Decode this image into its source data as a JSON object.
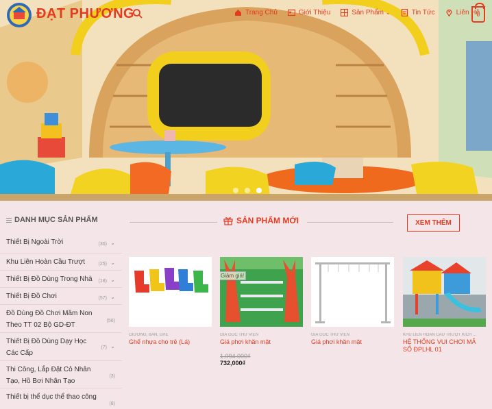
{
  "header": {
    "brand": "ĐẠT PHƯƠNG",
    "nav": [
      {
        "label": "Trang Chủ",
        "icon": "home-icon"
      },
      {
        "label": "Giới Thiệu",
        "icon": "id-card-icon"
      },
      {
        "label": "Sản Phẩm",
        "icon": "grid-icon",
        "dropdown": true
      },
      {
        "label": "Tin Tức",
        "icon": "document-icon"
      },
      {
        "label": "Liên Hệ",
        "icon": "map-pin-icon"
      }
    ],
    "cart_count": "0"
  },
  "sidebar": {
    "title": "DANH MỤC SẢN PHẨM",
    "categories": [
      {
        "label": "Thiết Bị Ngoài Trời",
        "count": "(36)"
      },
      {
        "label": "Khu Liên Hoàn Cầu Trượt",
        "count": "(25)"
      },
      {
        "label": "Thiết Bị Đồ Dùng Trong Nhà",
        "count": "(18)"
      },
      {
        "label": "Thiết Bị Đồ Chơi",
        "count": "(57)"
      },
      {
        "label": "Đồ Dùng Đồ Chơi Mầm Non Theo TT 02 Bộ GD-ĐT",
        "count": "(56)"
      },
      {
        "label": "Thiết Bị Đồ Dùng Dạy Học Các Cấp",
        "count": "(7)"
      },
      {
        "label": "Thi Công, Lắp Đặt Cỏ Nhân Tạo, Hồ Bơi Nhân Tạo",
        "count": "(3)"
      },
      {
        "label": "Thiết bị thể dục thể thao công",
        "count": "(8)"
      }
    ]
  },
  "section": {
    "title": "SẢN PHẨM MỚI",
    "more_button": "XEM THÊM"
  },
  "products": [
    {
      "category": "GIƯỜNG, BÀN, GHẾ",
      "name": "Ghế nhựa cho trẻ (Lá)",
      "old_price": "",
      "price": "",
      "badge": ""
    },
    {
      "category": "GIÁ GÓC THƯ VIỆN",
      "name": "Giá phơi khăn mặt",
      "old_price": "1.094.000₫",
      "price": "732,000₫",
      "badge": "Giảm giá!"
    },
    {
      "category": "GIÁ GÓC THƯ VIỆN",
      "name": "Giá phơi khăn mặt",
      "old_price": "",
      "price": "",
      "badge": ""
    },
    {
      "category": "KHU LIÊN HOÀN CẦU TRƯỢT KÍCH ...",
      "name": "HỆ THỐNG VUI CHƠI MÃ SỐ ĐPLHL 01",
      "old_price": "",
      "price": "",
      "badge": ""
    }
  ],
  "colors": {
    "accent": "#e33a20",
    "background": "#f4e6e8"
  },
  "slider": {
    "total": 3,
    "active_index": 3
  }
}
